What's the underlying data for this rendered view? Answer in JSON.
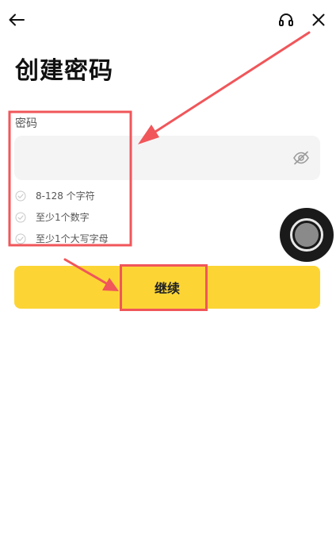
{
  "header": {
    "back_icon": "arrow-left-icon",
    "support_icon": "headset-icon",
    "close_icon": "close-icon"
  },
  "page": {
    "title": "创建密码"
  },
  "password": {
    "label": "密码",
    "value": "",
    "visibility_icon": "eye-off-icon"
  },
  "rules": [
    {
      "text": "8-128 个字符",
      "icon": "check-circle-icon"
    },
    {
      "text": "至少1个数字",
      "icon": "check-circle-icon"
    },
    {
      "text": "至少1个大写字母",
      "icon": "check-circle-icon"
    }
  ],
  "continue_button": {
    "label": "继续"
  },
  "colors": {
    "accent": "#fcd535",
    "field_background": "#f4f4f5",
    "annotation": "#f0565a"
  }
}
